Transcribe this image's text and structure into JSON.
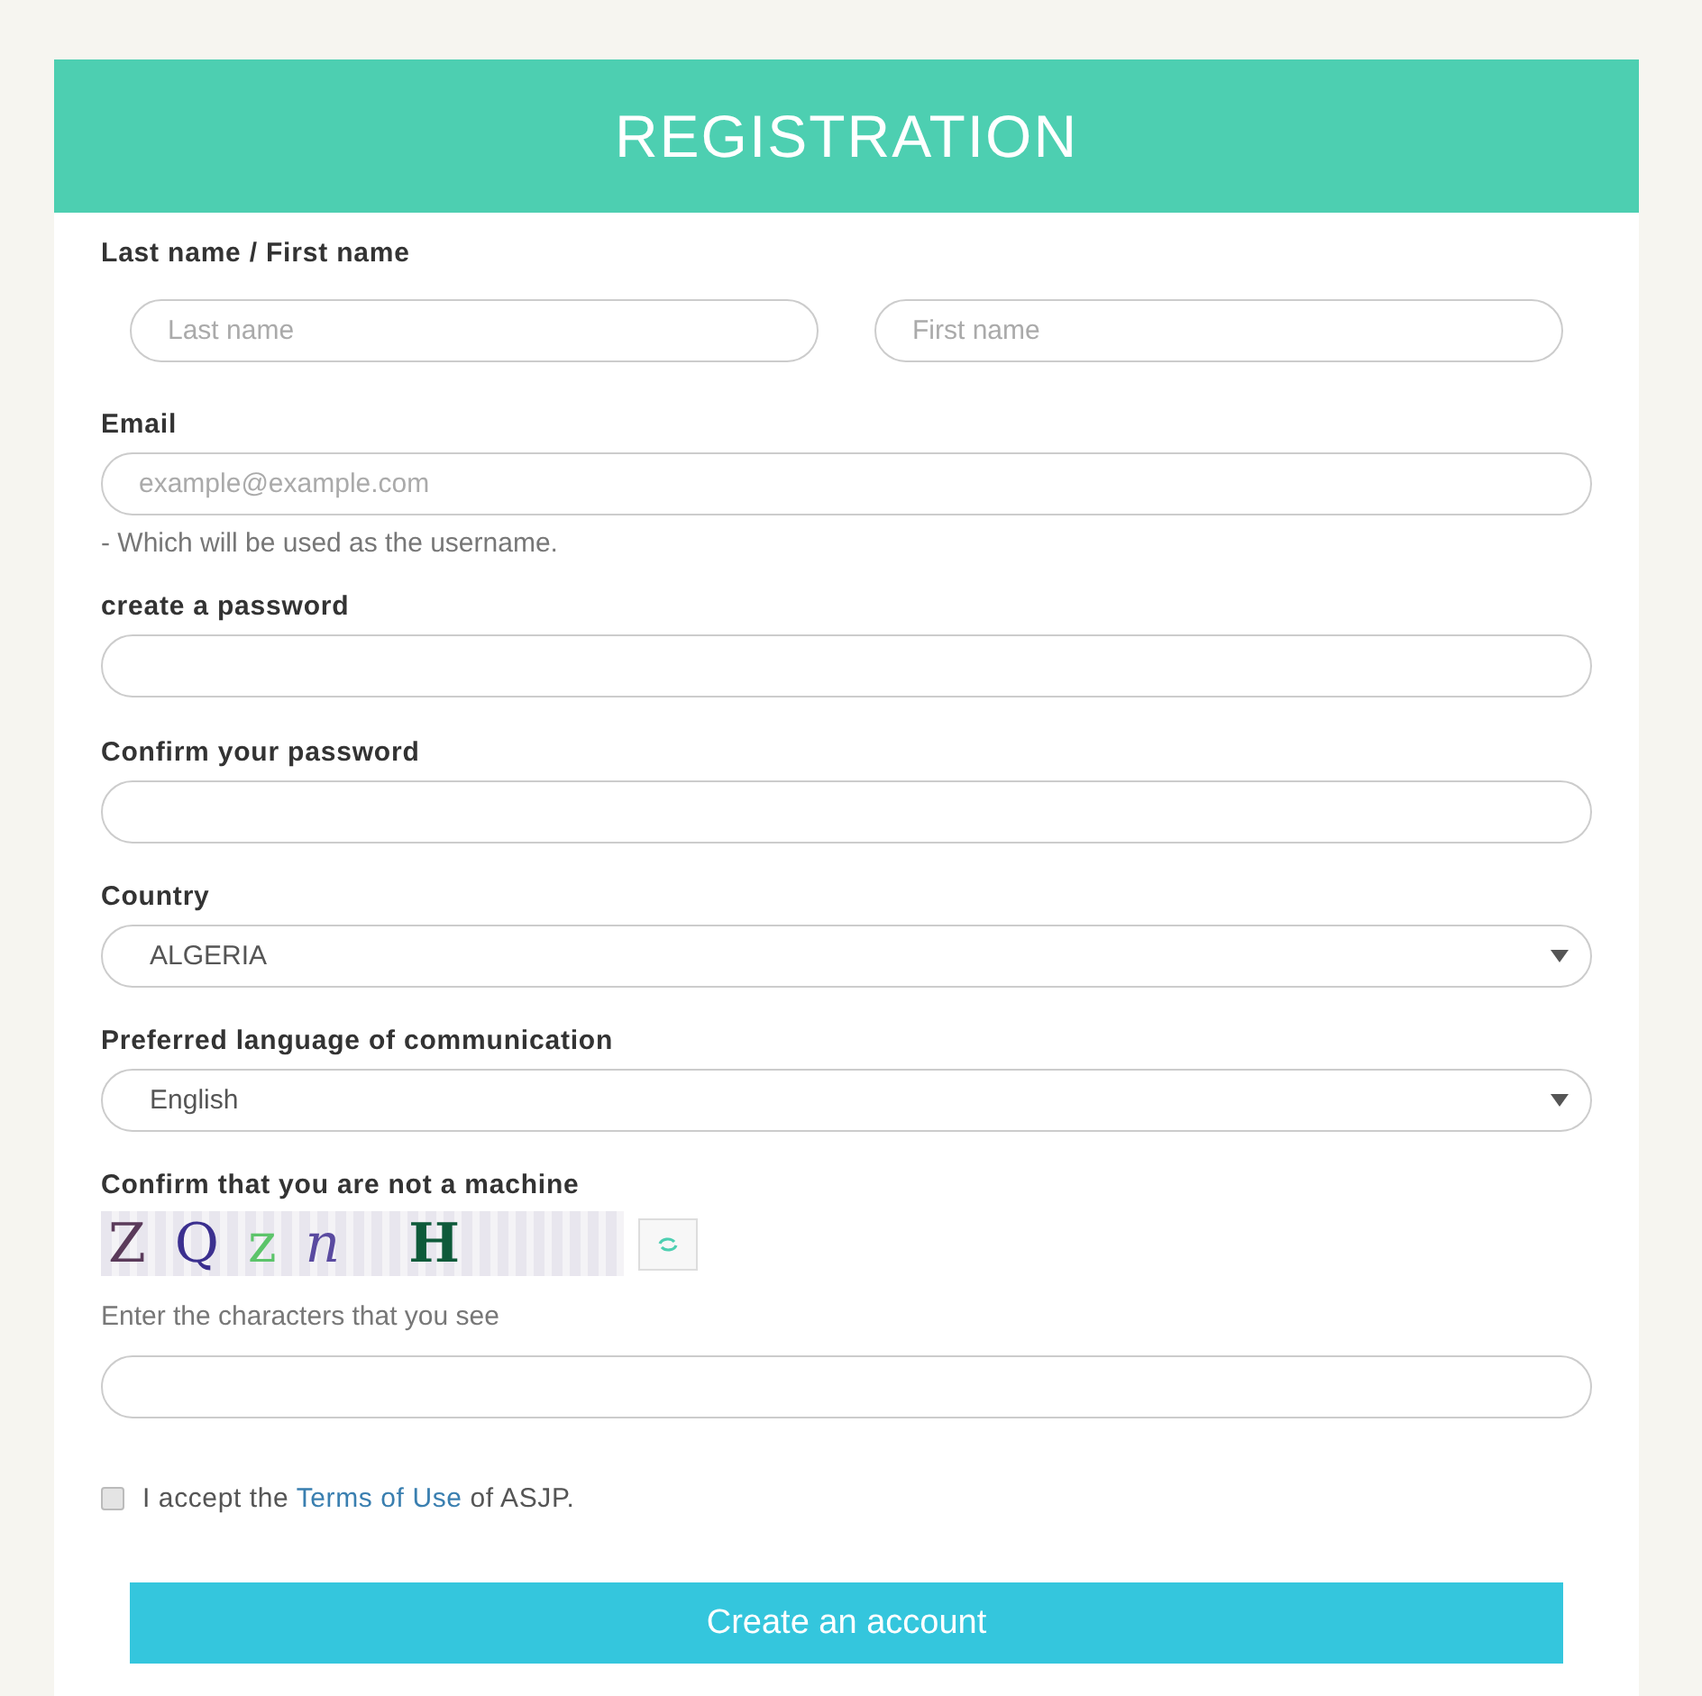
{
  "header": {
    "title": "REGISTRATION"
  },
  "name_section": {
    "label": "Last name / First name",
    "fields": [
      {
        "placeholder": "Last name"
      },
      {
        "placeholder": "First name"
      }
    ]
  },
  "email": {
    "label": "Email",
    "placeholder": "example@example.com",
    "hint": "- Which will be used as the username."
  },
  "password": {
    "label": "create a password"
  },
  "confirm_password": {
    "label": "Confirm your password"
  },
  "country": {
    "label": "Country",
    "value": "ALGERIA"
  },
  "language": {
    "label": "Preferred language of communication",
    "value": "English"
  },
  "captcha": {
    "label": "Confirm that you are not a machine",
    "characters": "Z Q z n H",
    "hint": "Enter the characters that you see"
  },
  "terms": {
    "checked": false,
    "before": "I accept the",
    "link": "Terms of Use",
    "after": "of ASJP."
  },
  "submit": {
    "label": "Create an account"
  }
}
